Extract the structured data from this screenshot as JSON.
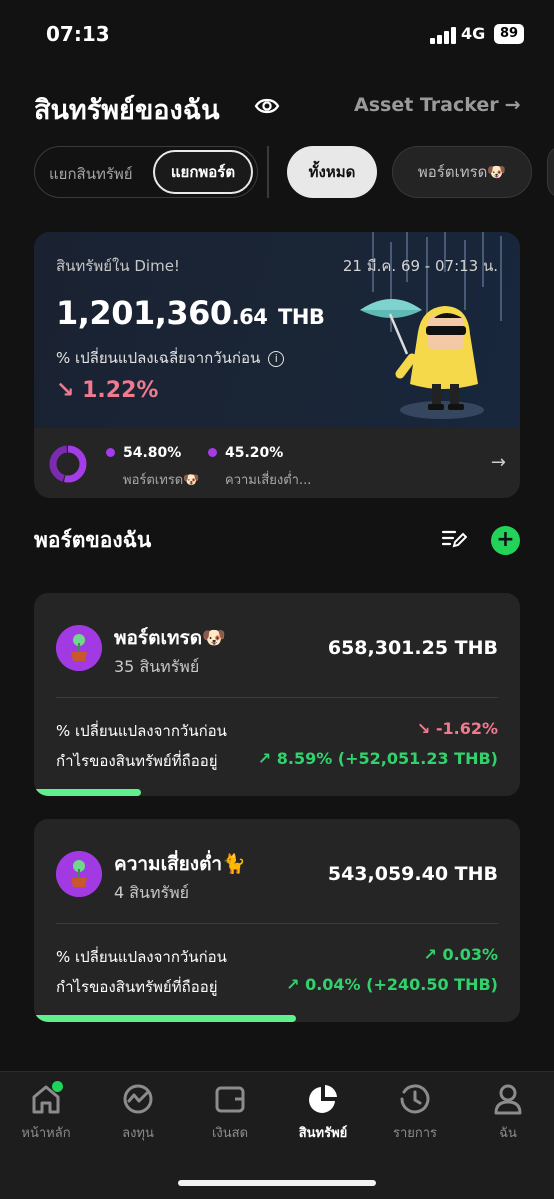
{
  "status_bar": {
    "time": "07:13",
    "network": "4G",
    "battery": "89"
  },
  "header": {
    "title": "สินทรัพย์ของฉัน",
    "asset_tracker": "Asset Tracker",
    "arrow": "→"
  },
  "tabs": {
    "segment": [
      "แยกสินทรัพย์",
      "แยกพอร์ต"
    ],
    "chips": [
      "ทั้งหมด",
      "พอร์ตเทรด🐶"
    ]
  },
  "summary": {
    "label": "สินทรัพย์ใน Dime!",
    "date": "21 มี.ค. 69 - 07:13 น.",
    "value_int": "1,201,360",
    "value_dec": ".64",
    "currency": "THB",
    "change_label": "% เปลี่ยนแปลงเฉลี่ยจากวันก่อน",
    "info": "i",
    "change": "↘ 1.22%",
    "allocation": [
      {
        "pct": "54.80%",
        "name": "พอร์ตเทรด🐶",
        "value": 54.8
      },
      {
        "pct": "45.20%",
        "name": "ความเสี่ยงต่ำ...",
        "value": 45.2
      }
    ],
    "arrow": "→"
  },
  "portfolios_section": {
    "title": "พอร์ตของฉัน",
    "add": "+"
  },
  "portfolios": [
    {
      "name": "พอร์ตเทรด🐶",
      "count": "35 สินทรัพย์",
      "value": "658,301.25 THB",
      "change_label": "% เปลี่ยนแปลงจากวันก่อน",
      "change": "↘ -1.62%",
      "profit_label": "กำไรของสินทรัพย์ที่ถืออยู่",
      "profit": "↗ 8.59% (+52,051.23 THB)",
      "share": 0.22
    },
    {
      "name": "ความเสี่ยงต่ำ🐈",
      "count": "4 สินทรัพย์",
      "value": "543,059.40 THB",
      "change_label": "% เปลี่ยนแปลงจากวันก่อน",
      "change": "↗  0.03%",
      "profit_label": "กำไรของสินทรัพย์ที่ถืออยู่",
      "profit": "↗ 0.04% (+240.50 THB)",
      "share": 0.54
    }
  ],
  "nav": {
    "items": [
      "หน้าหลัก",
      "ลงทุน",
      "เงินสด",
      "สินทรัพย์",
      "รายการ",
      "ฉัน"
    ],
    "active": "สินทรัพย์"
  },
  "colors": {
    "accent_green": "#22d35a",
    "negative": "#f07a8e",
    "positive": "#31d26c",
    "purple": "#a43ce8"
  }
}
